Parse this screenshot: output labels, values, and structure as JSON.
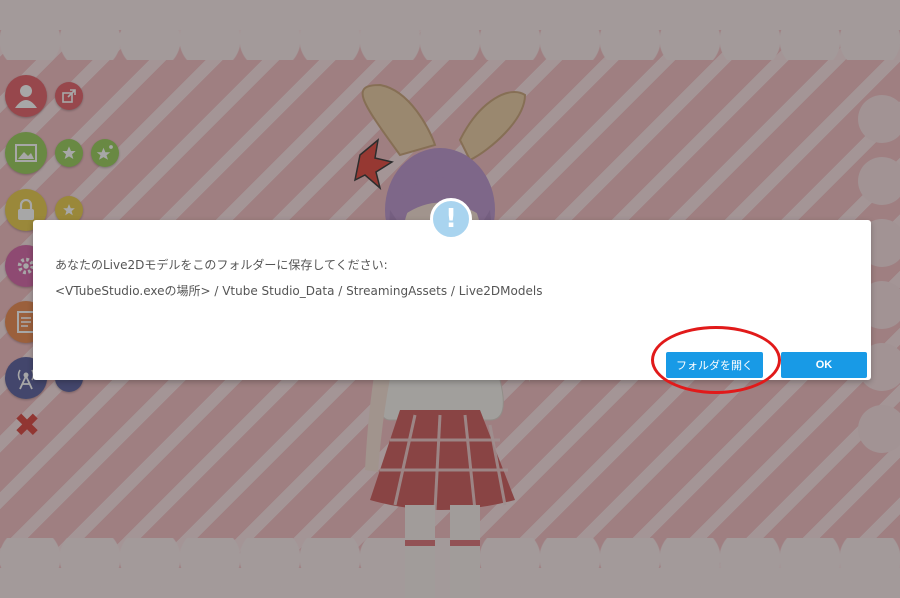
{
  "dialog": {
    "alert_symbol": "!",
    "message_line1": "あなたのLive2Dモデルをこのフォルダーに保存してください:",
    "message_line2": "<VTubeStudio.exeの場所> / Vtube Studio_Data / StreamingAssets / Live2DModels",
    "open_folder_label": "フォルダを開く",
    "ok_label": "OK"
  },
  "toolbar": {
    "close_glyph": "✖"
  },
  "colors": {
    "button_blue": "#189ae6",
    "alert_blue": "#a9d4ef",
    "highlight_red": "#e11a1a",
    "background_pink": "#f1b6bb"
  },
  "icons": [
    "person-icon",
    "export-icon",
    "image-icon",
    "star-icon",
    "star-sparkle-icon",
    "lock-icon",
    "star-small-icon",
    "gear-icon",
    "document-icon",
    "antenna-icon",
    "close-icon"
  ]
}
